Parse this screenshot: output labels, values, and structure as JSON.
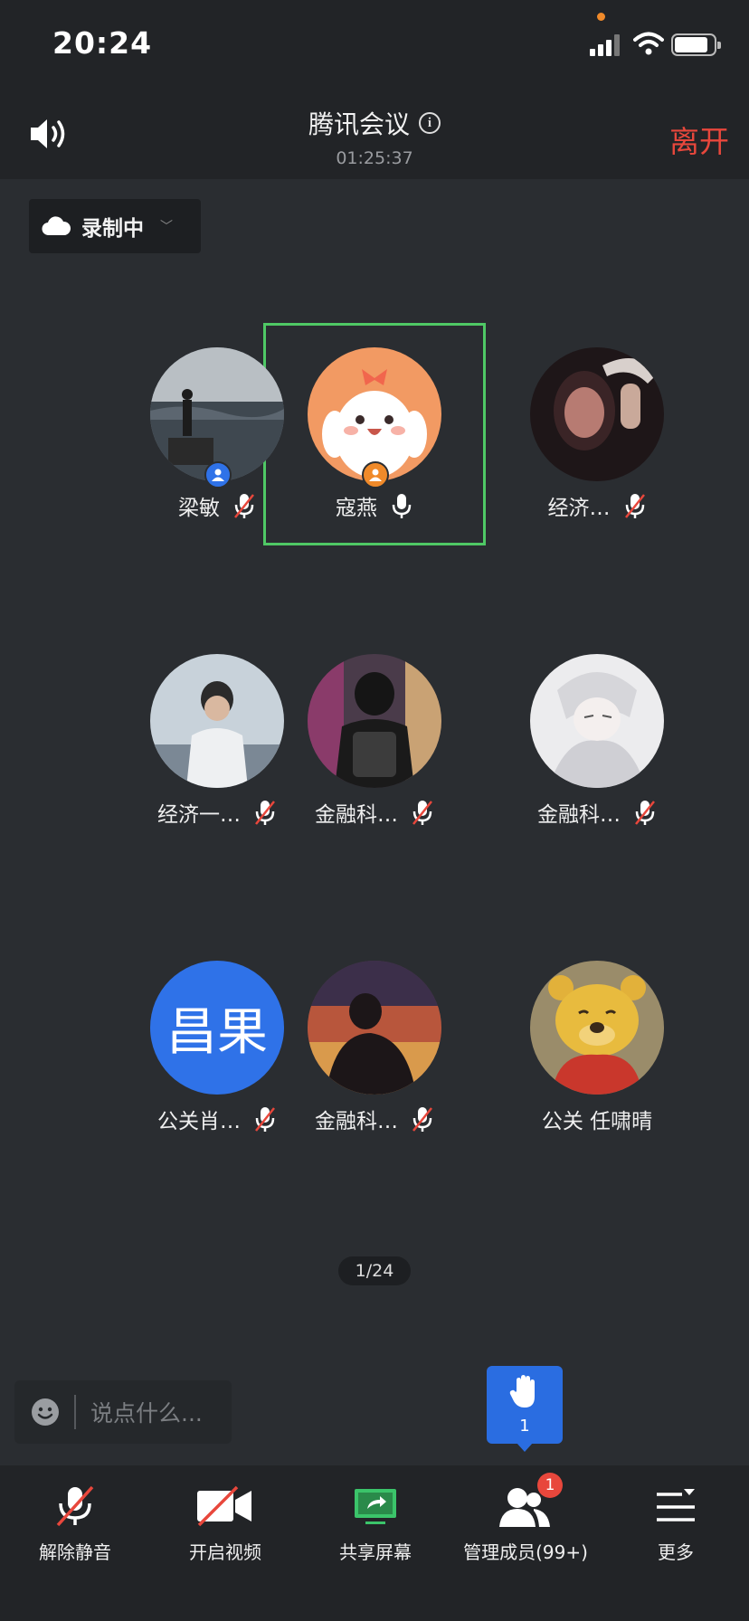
{
  "status_bar": {
    "time": "20:24"
  },
  "header": {
    "title": "腾讯会议",
    "duration": "01:25:37",
    "leave_label": "离开"
  },
  "recording": {
    "label": "录制中"
  },
  "participants": [
    {
      "name": "梁敏",
      "mic": "muted",
      "host": true,
      "avatar_color": "#6a7680"
    },
    {
      "name": "寇燕",
      "mic": "on",
      "host": true,
      "speaking": true,
      "avatar_color": "#f29a63"
    },
    {
      "name": "经济…",
      "mic": "muted",
      "avatar_color": "#2b2224"
    },
    {
      "name": "经济一…",
      "mic": "muted",
      "avatar_color": "#9aa7b3"
    },
    {
      "name": "金融科…",
      "mic": "muted",
      "avatar_color": "#4a3b4a"
    },
    {
      "name": "金融科…",
      "mic": "muted",
      "avatar_color": "#e8e8ea"
    },
    {
      "name": "公关肖…",
      "mic": "muted",
      "avatar_text": "昌果",
      "avatar_color": "#2f72e8"
    },
    {
      "name": "金融科…",
      "mic": "muted",
      "avatar_color": "#6a4a4e"
    },
    {
      "name": "公关 任啸晴",
      "mic": "none",
      "avatar_color": "#d8b23a"
    }
  ],
  "pager": {
    "text": "1/24"
  },
  "chat": {
    "placeholder": "说点什么..."
  },
  "raise_hand": {
    "count": "1"
  },
  "toolbar": [
    {
      "label": "解除静音",
      "icon": "mic-muted-icon"
    },
    {
      "label": "开启视频",
      "icon": "video-off-icon"
    },
    {
      "label": "共享屏幕",
      "icon": "share-screen-icon"
    },
    {
      "label": "管理成员(99+)",
      "icon": "members-icon",
      "badge": "1"
    },
    {
      "label": "更多",
      "icon": "more-menu-icon"
    }
  ],
  "colors": {
    "accent": "#2a6de1",
    "danger": "#e8473c",
    "speaking_frame": "#4fc865",
    "background": "#2a2d31"
  }
}
